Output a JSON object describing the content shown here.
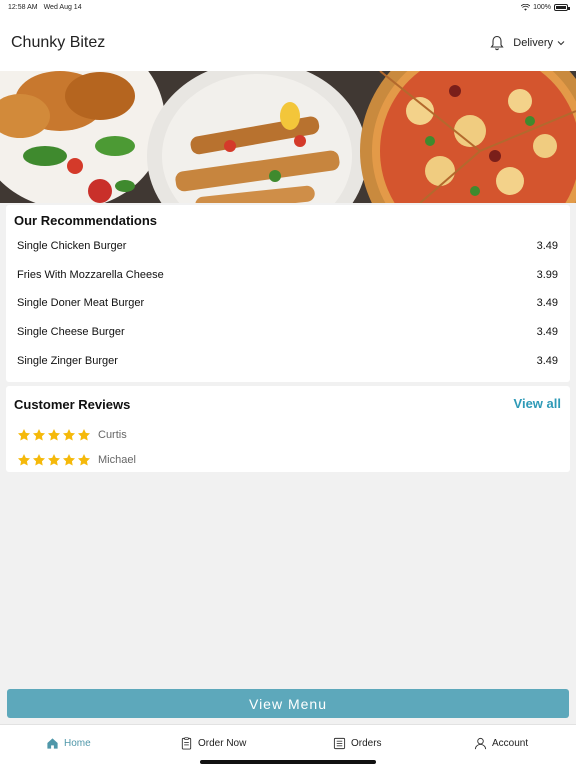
{
  "status_bar": {
    "time": "12:58 AM",
    "date": "Wed Aug 14",
    "battery": "100%"
  },
  "header": {
    "title": "Chunky Bitez",
    "delivery_label": "Delivery",
    "bell_icon": "bell-icon",
    "chevron_icon": "chevron-down-icon"
  },
  "recommendations": {
    "title": "Our Recommendations",
    "items": [
      {
        "name": "Single Chicken Burger",
        "price": "3.49"
      },
      {
        "name": "Fries With Mozzarella Cheese",
        "price": "3.99"
      },
      {
        "name": "Single Doner Meat Burger",
        "price": "3.49"
      },
      {
        "name": "Single Cheese Burger",
        "price": "3.49"
      },
      {
        "name": "Single Zinger Burger",
        "price": "3.49"
      }
    ]
  },
  "reviews": {
    "title": "Customer Reviews",
    "view_all": "View all",
    "items": [
      {
        "name": "Curtis",
        "rating": 5
      },
      {
        "name": "Michael",
        "rating": 5
      }
    ]
  },
  "view_menu_label": "View Menu",
  "tabs": [
    {
      "label": "Home",
      "icon": "home-icon",
      "active": true
    },
    {
      "label": "Order Now",
      "icon": "order-icon",
      "active": false
    },
    {
      "label": "Orders",
      "icon": "orders-list-icon",
      "active": false
    },
    {
      "label": "Account",
      "icon": "account-icon",
      "active": false
    }
  ],
  "colors": {
    "accent": "#5da8bb",
    "link": "#2e9ab7",
    "star": "#f5b90a",
    "active_tab": "#4f97a9"
  }
}
